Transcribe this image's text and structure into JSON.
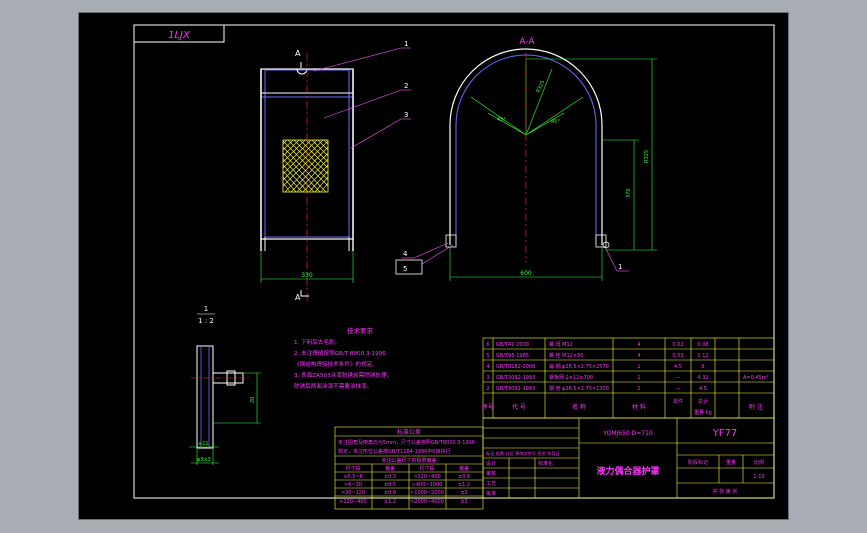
{
  "colors": {
    "background": "#a8adb4",
    "sheet": "#000000",
    "frame": "#ffffff",
    "outline": "#ffffff",
    "text": "#ff33ff",
    "part": "#6a6aff",
    "mesh": "#ffff33",
    "dimension": "#33ff33",
    "leader": "#ff55ff",
    "centerline": "#ff3333"
  },
  "title_block_corner": "1LJX",
  "section_label": "A-A",
  "cut_mark": "A",
  "detail_label": "1",
  "detail_scale": "1 : 2",
  "balloons": [
    "1",
    "2",
    "3",
    "4",
    "5",
    "1"
  ],
  "dimensions": {
    "front_width": "330",
    "section_width": "600",
    "section_height": "370",
    "section_total_height": "R325",
    "radius_a": "R325",
    "angle_a": "45°",
    "angle_b": "45°",
    "detail_height": "20",
    "detail_bottom_a": "≥11",
    "detail_bottom_b": "φ3×3"
  },
  "tech_notes": {
    "title": "技术要求",
    "lines": [
      "1. 下料后去毛刺。",
      "2. 未注焊缝按照GB/T 8900.3-1996",
      "   《钢结构焊接技术条件》的规定。",
      "3. 表面ZA503涂漆防锈前需除锈处理，",
      "   除锈后两面涂漆不需要涂抹漆。"
    ]
  },
  "tolerance_block": {
    "title": "标准公差",
    "lines": [
      "未注圆角及倒角均为5mm，尺寸公差按照GB/T8000.3-1996",
      "规定，未注形位公差按GB/T1184-1996中K级执行"
    ],
    "subtitle": "未注公差尺寸的极限偏差",
    "headers": [
      "尺寸段",
      "偏差",
      "尺寸段",
      "偏差"
    ],
    "rows": [
      [
        "≥0.5~6",
        "±0.3",
        ">120~400",
        "±0.8"
      ],
      [
        ">6~30",
        "±0.5",
        ">400~1000",
        "±1.2"
      ],
      [
        ">30~120",
        "±0.8",
        ">1000~2000",
        "±2"
      ],
      [
        ">120~400",
        "±1.2",
        ">2000~4000",
        "±3"
      ]
    ]
  },
  "parts_list": {
    "rows": [
      [
        "6",
        "GB/T41-2000",
        "螺  母 M12",
        "4",
        "0.02",
        "0.08",
        ""
      ],
      [
        "5",
        "GB/T95-1985",
        "螺  栓 M12×30",
        "4",
        "0.03",
        "0.12",
        ""
      ],
      [
        "4",
        "GB/T8162-2008",
        "扁  钢 φ26.5×2.75×2570",
        "1",
        "4.5",
        "9",
        ""
      ],
      [
        "3",
        "GB/T3092-1993",
        "钢板网 2×12×700",
        "1",
        "—",
        "4.32",
        "A=0.45m²"
      ],
      [
        "2",
        "GB/T3091-1993",
        "钢  管 φ26.5×2.75×1300",
        "1",
        "—",
        "4.5",
        ""
      ],
      [
        "1",
        "",
        "",
        "",
        "",
        "",
        ""
      ]
    ],
    "headers": [
      "序号",
      "代  号",
      "名  称",
      "材  料",
      "单件",
      "总计",
      "附  注"
    ],
    "weight_unit": "重量 kg"
  },
  "title_block": {
    "model": "YOMJ650  D=710",
    "code": "YF77",
    "name": "液力偶合器护罩",
    "stage_label": "阶段标记",
    "weight_label": "重量",
    "scale_label": "比例",
    "scale_value": "1:10",
    "sheet_label": "共   张   第   张",
    "rows_left": [
      "标记 处数 分区 更改文件号 签名 年月日",
      "设计",
      "审核",
      "工艺",
      "批准"
    ],
    "std_label": "标准化"
  }
}
